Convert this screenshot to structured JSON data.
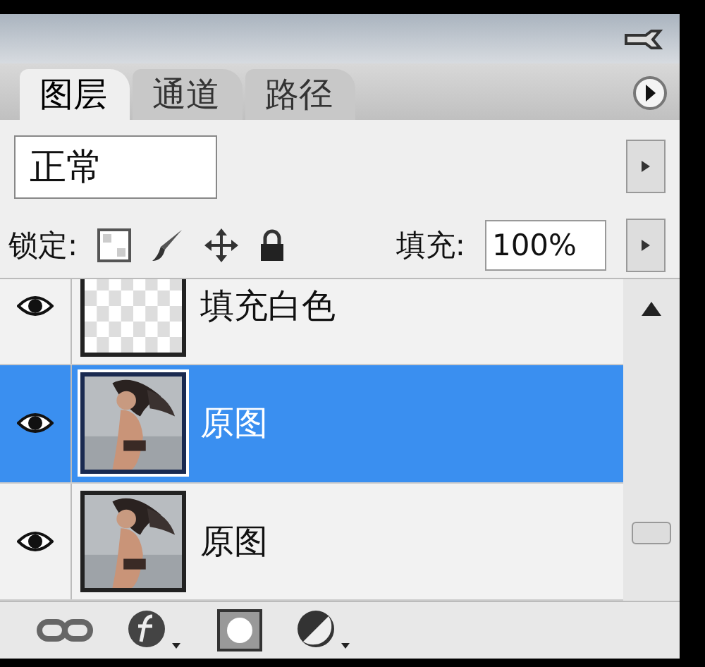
{
  "tabs": [
    {
      "label": "图层",
      "selected": true
    },
    {
      "label": "通道",
      "selected": false
    },
    {
      "label": "路径",
      "selected": false
    }
  ],
  "blend_mode": "正常",
  "lock_label": "锁定:",
  "fill_label": "填充:",
  "fill_value": "100%",
  "layers": [
    {
      "name": "填充白色",
      "kind": "transparent",
      "visible": true,
      "selected": false
    },
    {
      "name": "原图",
      "visible": true,
      "selected": true
    },
    {
      "name": "原图",
      "visible": true,
      "selected": false
    }
  ]
}
